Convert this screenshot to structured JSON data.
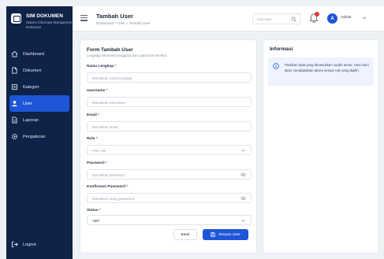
{
  "brand": {
    "title": "SIM DOKUMEN",
    "subtitle": "Sistem Informasi Manajemen Dokumen"
  },
  "sidebar": {
    "items": [
      {
        "label": "Dashboard",
        "icon": "home-icon"
      },
      {
        "label": "Dokumen",
        "icon": "document-icon"
      },
      {
        "label": "Kategori",
        "icon": "folder-icon"
      },
      {
        "label": "User",
        "icon": "user-icon",
        "active": true
      },
      {
        "label": "Laporan",
        "icon": "report-icon"
      },
      {
        "label": "Pengaturan",
        "icon": "gear-icon"
      }
    ],
    "logout": "Logout"
  },
  "header": {
    "title": "Tambah User",
    "breadcrumb": "Dashboard  >  User  >  Tambah User",
    "search_placeholder": "Cari user...",
    "user_initial": "A",
    "user_name": "Admin"
  },
  "form": {
    "title": "Form Tambah User",
    "subtitle": "Lengkapi informasi pengguna baru pada form berikut.",
    "fields": {
      "nama": {
        "label": "Nama Lengkap",
        "placeholder": "Masukkan nama lengkap"
      },
      "username": {
        "label": "Username",
        "placeholder": "Masukkan username"
      },
      "email": {
        "label": "Email",
        "placeholder": "Masukkan email"
      },
      "role": {
        "label": "Role",
        "placeholder": "Pilih role"
      },
      "password": {
        "label": "Password",
        "placeholder": "Masukkan password"
      },
      "konfirmasi": {
        "label": "Konfirmasi Password",
        "placeholder": "Masukkan ulang password"
      },
      "status": {
        "label": "Status",
        "value": "Aktif"
      }
    },
    "cancel_label": "Batal",
    "save_label": "Simpan User"
  },
  "info": {
    "title": "Informasi",
    "text": "Pastikan data yang dimasukkan sudah benar. User baru akan mendapatkan akses sesuai role yang dipilih."
  },
  "colors": {
    "sidebar": "#0f2247",
    "accent": "#1e56d8",
    "badge": "#e53935"
  }
}
